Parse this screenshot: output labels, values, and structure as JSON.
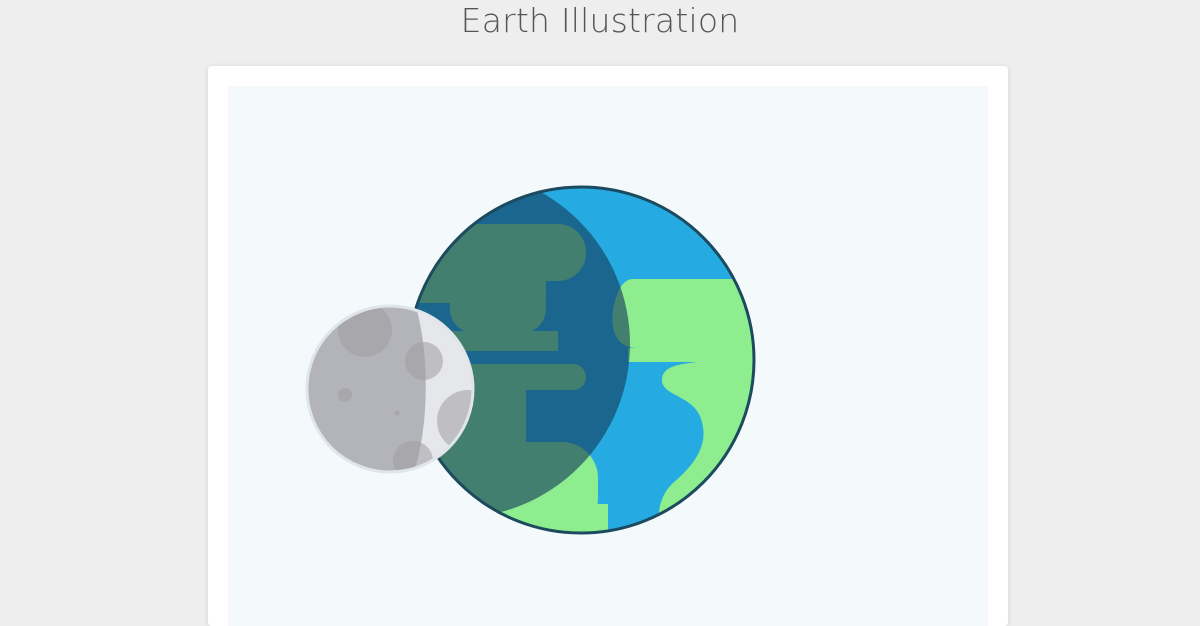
{
  "page": {
    "title": "Earth Illustration"
  },
  "illustration": {
    "subject": "earth-and-moon",
    "colors": {
      "background": "#eeeeee",
      "card": "#ffffff",
      "canvas": "#f4f9fc",
      "ocean": "#25aae1",
      "land": "#8eed8e",
      "outline": "#1c4a5e",
      "shadow": "#153c5a",
      "moon_surface": "#e6e7eb",
      "moon_shadow": "#b3b4b9",
      "moon_crater": "#9c9ca2",
      "moon_outline": "#dfe5ea"
    }
  }
}
